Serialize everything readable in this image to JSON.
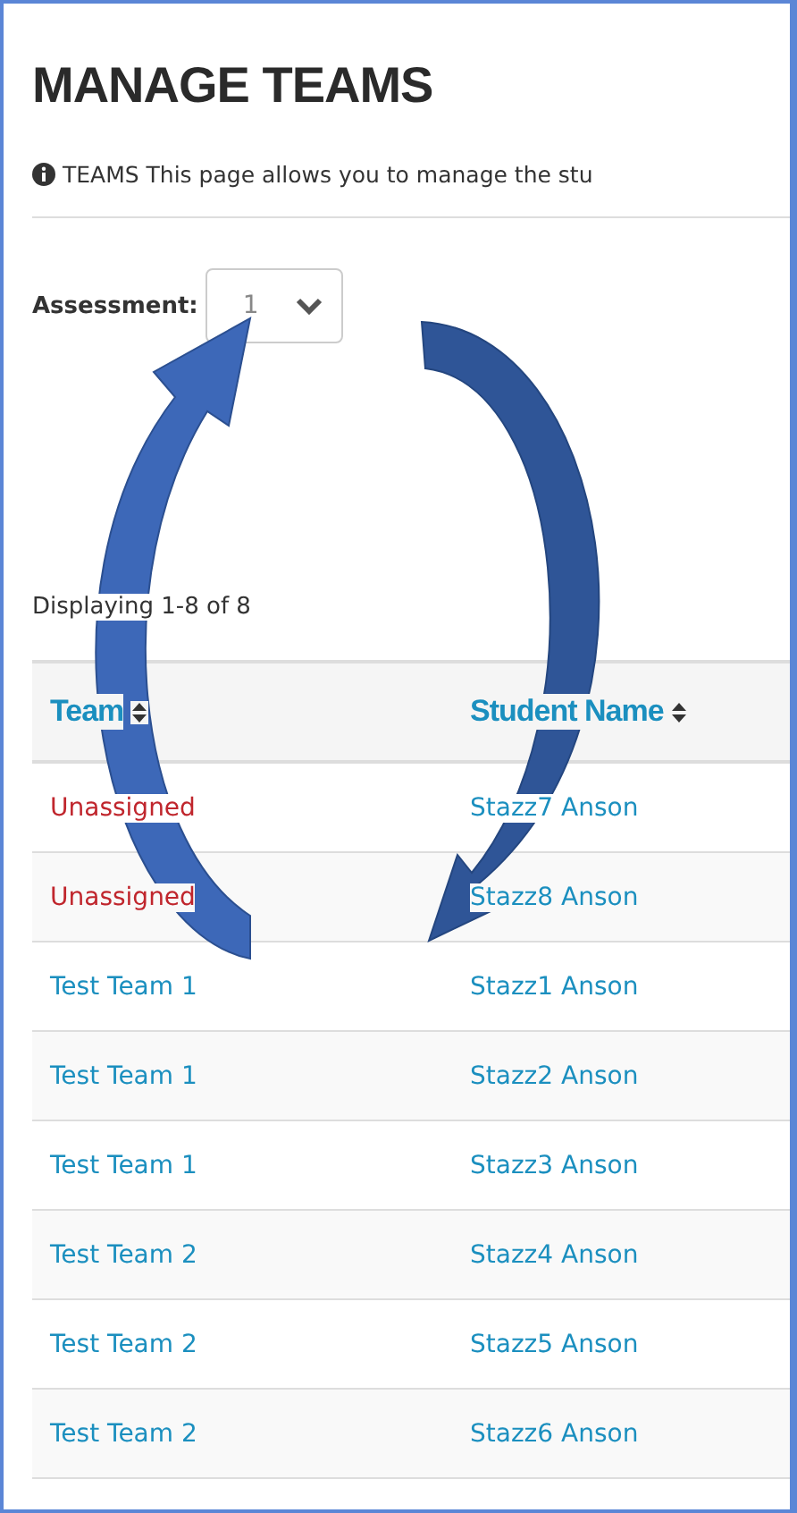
{
  "title": "MANAGE TEAMS",
  "info": {
    "label": "TEAMS",
    "text": "This page allows you to manage the stu"
  },
  "assessment": {
    "label": "Assessment:",
    "value": "1"
  },
  "summary": "Displaying 1-8 of 8",
  "table": {
    "columns": [
      {
        "label": "Team",
        "sortable": true
      },
      {
        "label": "Student Name",
        "sortable": true
      }
    ],
    "rows": [
      {
        "team": "Unassigned",
        "assigned": false,
        "student": "Stazz7 Anson"
      },
      {
        "team": "Unassigned",
        "assigned": false,
        "student": "Stazz8 Anson"
      },
      {
        "team": "Test Team 1",
        "assigned": true,
        "student": "Stazz1 Anson"
      },
      {
        "team": "Test Team 1",
        "assigned": true,
        "student": "Stazz2 Anson"
      },
      {
        "team": "Test Team 1",
        "assigned": true,
        "student": "Stazz3 Anson"
      },
      {
        "team": "Test Team 2",
        "assigned": true,
        "student": "Stazz4 Anson"
      },
      {
        "team": "Test Team 2",
        "assigned": true,
        "student": "Stazz5 Anson"
      },
      {
        "team": "Test Team 2",
        "assigned": true,
        "student": "Stazz6 Anson"
      }
    ]
  }
}
